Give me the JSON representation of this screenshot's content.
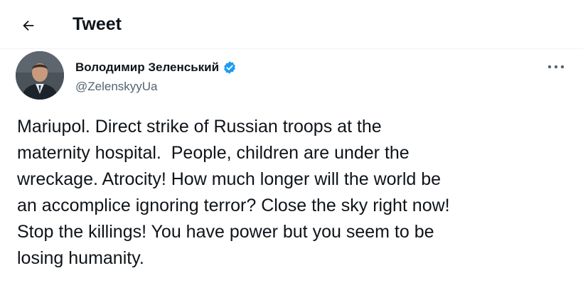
{
  "header": {
    "title": "Tweet",
    "back_icon": "arrow-left-icon"
  },
  "author": {
    "name": "Володимир Зеленський",
    "handle": "@ZelenskyyUa",
    "verified_icon": "verified-badge-icon",
    "more_icon": "more-horizontal-icon",
    "colors": {
      "verified": "#1d9bf0",
      "handle": "#536471"
    }
  },
  "tweet": {
    "text": "Mariupol. Direct strike of Russian troops at the\nmaternity hospital.  People, children are under the\nwreckage. Atrocity! How much longer will the world be\nan accomplice ignoring terror? Close the sky right now!\nStop the killings! You have power but you seem to be\nlosing humanity."
  }
}
